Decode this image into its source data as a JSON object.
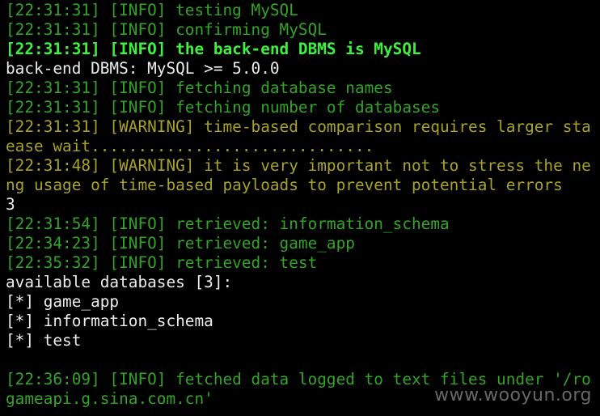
{
  "terminal": {
    "lines": [
      {
        "text": "[22:31:31] [INFO] testing MySQL",
        "color": "#33a526"
      },
      {
        "text": "[22:31:31] [INFO] confirming MySQL",
        "color": "#33a526"
      },
      {
        "text": "[22:31:31] [INFO] the back-end DBMS is MySQL",
        "color": "#3df23d"
      },
      {
        "text": "back-end DBMS: MySQL >= 5.0.0",
        "color": "#ececec"
      },
      {
        "text": "[22:31:31] [INFO] fetching database names",
        "color": "#33a526"
      },
      {
        "text": "[22:31:31] [INFO] fetching number of databases",
        "color": "#33a526"
      },
      {
        "text": "[22:31:31] [WARNING] time-based comparison requires larger sta",
        "color": "#a8a227"
      },
      {
        "text": "ease wait..............................",
        "color": "#a8a227"
      },
      {
        "text": "[22:31:48] [WARNING] it is very important not to stress the ne",
        "color": "#a8a227"
      },
      {
        "text": "ng usage of time-based payloads to prevent potential errors",
        "color": "#a8a227"
      },
      {
        "text": "3",
        "color": "#ececec"
      },
      {
        "text": "[22:31:54] [INFO] retrieved: information_schema",
        "color": "#33a526"
      },
      {
        "text": "[22:34:23] [INFO] retrieved: game_app",
        "color": "#33a526"
      },
      {
        "text": "[22:35:32] [INFO] retrieved: test",
        "color": "#33a526"
      },
      {
        "text": "available databases [3]:",
        "color": "#ececec"
      },
      {
        "text": "[*] game_app",
        "color": "#ececec"
      },
      {
        "text": "[*] information_schema",
        "color": "#ececec"
      },
      {
        "text": "[*] test",
        "color": "#ececec"
      },
      {
        "text": "",
        "color": "#ececec"
      },
      {
        "text": "[22:36:09] [INFO] fetched data logged to text files under '/ro",
        "color": "#33a526"
      },
      {
        "text": "gameapi.g.sina.com.cn'",
        "color": "#33a526"
      }
    ],
    "watermark": "www.wooyun.org"
  }
}
